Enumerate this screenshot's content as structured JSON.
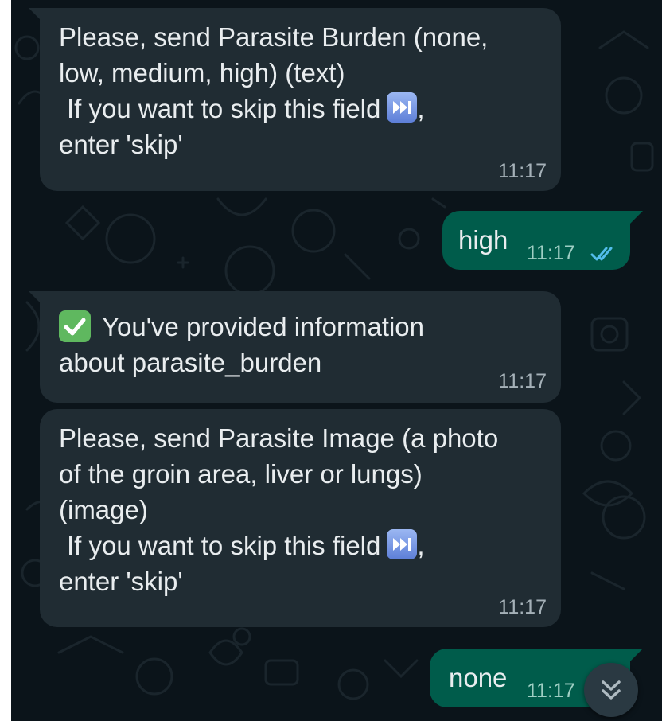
{
  "messages": [
    {
      "direction": "incoming",
      "lines": [
        "Please, send Parasite Burden (none,",
        "low, medium, high) (text)"
      ],
      "skip_prefix": "If you want to skip this field",
      "skip_suffix": ",",
      "skip_last_line": "enter 'skip'",
      "time": "11:17"
    },
    {
      "direction": "outgoing",
      "text": "high",
      "time": "11:17",
      "status": "read"
    },
    {
      "direction": "incoming",
      "line1": "You've provided information",
      "line2": "about parasite_burden",
      "time": "11:17"
    },
    {
      "direction": "incoming",
      "lines": [
        "Please, send Parasite Image (a photo",
        "of the groin area, liver or lungs)",
        "(image)"
      ],
      "skip_prefix": "If you want to skip this field",
      "skip_suffix": ",",
      "skip_last_line": "enter 'skip'",
      "time": "11:17"
    },
    {
      "direction": "outgoing",
      "text": "none",
      "time": "11:17"
    }
  ],
  "icons": {
    "skip": "next-track-emoji-icon",
    "check": "check-mark-button-emoji-icon",
    "read": "double-check-icon",
    "scroll": "chevron-double-down-icon"
  },
  "colors": {
    "background": "#0b141a",
    "incoming_bubble": "#202c33",
    "outgoing_bubble": "#005c4b",
    "read_ticks": "#53bdeb"
  }
}
